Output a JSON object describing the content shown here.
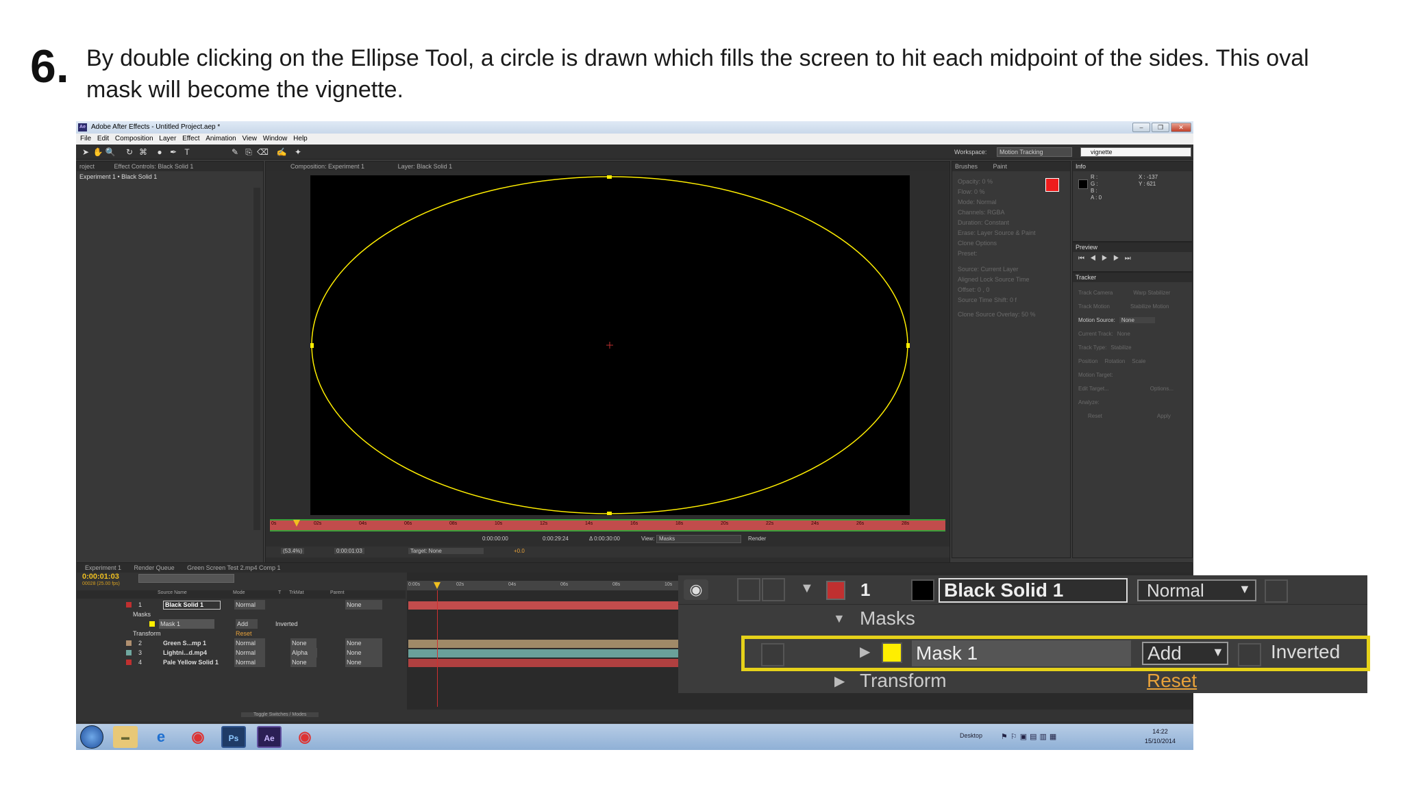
{
  "step_number": "6.",
  "instruction": "By double clicking on the Ellipse Tool, a circle is drawn which fills the screen to hit each midpoint of the sides. This oval mask will become the vignette.",
  "window": {
    "title": "Adobe After Effects - Untitled Project.aep *",
    "logo": "Ae",
    "minimize": "–",
    "restore": "❐",
    "close": "✕"
  },
  "menu": [
    "File",
    "Edit",
    "Composition",
    "Layer",
    "Effect",
    "Animation",
    "View",
    "Window",
    "Help"
  ],
  "toolbar": {
    "workspace_label": "Workspace:",
    "workspace_value": "Motion Tracking",
    "search_value": "vignette"
  },
  "left_panel": {
    "tab_project": "roject",
    "tab_effect_controls": "Effect Controls: Black Solid 1",
    "breadcrumb": "Experiment 1 • Black Solid 1"
  },
  "viewer": {
    "tab_composition": "Composition: Experiment 1",
    "tab_layer": "Layer: Black Solid 1",
    "ruler_ticks": [
      "0s",
      "02s",
      "04s",
      "06s",
      "08s",
      "10s",
      "12s",
      "14s",
      "16s",
      "18s",
      "20s",
      "22s",
      "24s",
      "26s",
      "28s"
    ],
    "time_current": "0:00:00:00",
    "time_end": "0:00:29:24",
    "time_duration": "Δ 0:00:30:00",
    "view_label": "View:",
    "view_value": "Masks",
    "render_label": "Render",
    "zoom_value": "(53.4%)",
    "timecode": "0:00:01:03",
    "target_value": "Target: None",
    "exposure": "+0.0"
  },
  "paint_panel": {
    "tab_brushes": "Brushes",
    "tab_paint": "Paint",
    "rows": [
      "Opacity: 0 %",
      "Flow: 0 %",
      "Mode:  Normal",
      "Channels:  RGBA",
      "Duration:  Constant",
      "Erase:  Layer Source & Paint",
      "Clone Options",
      "Preset:",
      "Source:  Current Layer",
      "Aligned     Lock Source Time",
      "Offset: 0 ,  0",
      "Source Time Shift: 0 f",
      "Clone Source Overlay: 50 %"
    ]
  },
  "info_panel": {
    "tab": "Info",
    "r": "R :",
    "g": "G :",
    "b": "B :",
    "a": "A : 0",
    "x": "X : -137",
    "y": "Y : 621"
  },
  "preview_panel": {
    "tab": "Preview"
  },
  "tracker_panel": {
    "tab": "Tracker",
    "track_camera": "Track Camera",
    "warp_stabilizer": "Warp Stabilizer",
    "track_motion": "Track Motion",
    "stabilize_motion": "Stabilize Motion",
    "motion_source_label": "Motion Source:",
    "motion_source_value": "None",
    "current_track": "Current Track:",
    "current_track_value": "None",
    "track_type": "Track Type:",
    "track_type_value": "Stabilize",
    "position": "Position",
    "rotation": "Rotation",
    "scale": "Scale",
    "motion_target": "Motion Target:",
    "edit_target": "Edit Target...",
    "options": "Options...",
    "analyze": "Analyze:",
    "reset": "Reset",
    "apply": "Apply"
  },
  "timeline": {
    "tabs": [
      "Experiment 1",
      "Render Queue",
      "Green Screen Test 2.mp4 Comp 1"
    ],
    "timecode": "0:00:01:03",
    "frame_info": "00028 (25.00 fps)",
    "col_source": "Source Name",
    "col_mode": "Mode",
    "col_t": "T",
    "col_trkmat": "TrkMat",
    "col_parent": "Parent",
    "ruler": [
      "0:00s",
      "02s",
      "04s",
      "06s",
      "08s",
      "10s"
    ],
    "layers": [
      {
        "num": "1",
        "name": "Black Solid 1",
        "mode": "Normal",
        "trkmat": "",
        "parent": "None",
        "color": "#c03030"
      },
      {
        "num": "2",
        "name": "Green S...mp 1",
        "mode": "Normal",
        "trkmat": "None",
        "parent": "None",
        "color": "#b09070"
      },
      {
        "num": "3",
        "name": "Lightni...d.mp4",
        "mode": "Normal",
        "trkmat": "Alpha",
        "parent": "None",
        "color": "#70a8a0"
      },
      {
        "num": "4",
        "name": "Pale Yellow Solid 1",
        "mode": "Normal",
        "trkmat": "None",
        "parent": "None",
        "color": "#c03030"
      }
    ],
    "masks_label": "Masks",
    "mask_name": "Mask 1",
    "mask_mode": "Add",
    "inverted": "Inverted",
    "transform": "Transform",
    "reset": "Reset",
    "toggle": "Toggle Switches / Modes"
  },
  "taskbar": {
    "desktop": "Desktop",
    "time": "14:22",
    "date": "15/10/2014",
    "ps": "Ps",
    "ae": "Ae"
  },
  "zoom_callout": {
    "layer_num": "1",
    "layer_name": "Black Solid 1",
    "mode": "Normal",
    "masks": "Masks",
    "mask_name": "Mask 1",
    "mask_mode": "Add",
    "inverted": "Inverted",
    "transform": "Transform",
    "reset": "Reset"
  },
  "colors": {
    "highlight": "#e6d21a",
    "mask_yellow": "#ffee00",
    "layer_red": "#c03030",
    "accent_orange": "#e8a23a"
  }
}
